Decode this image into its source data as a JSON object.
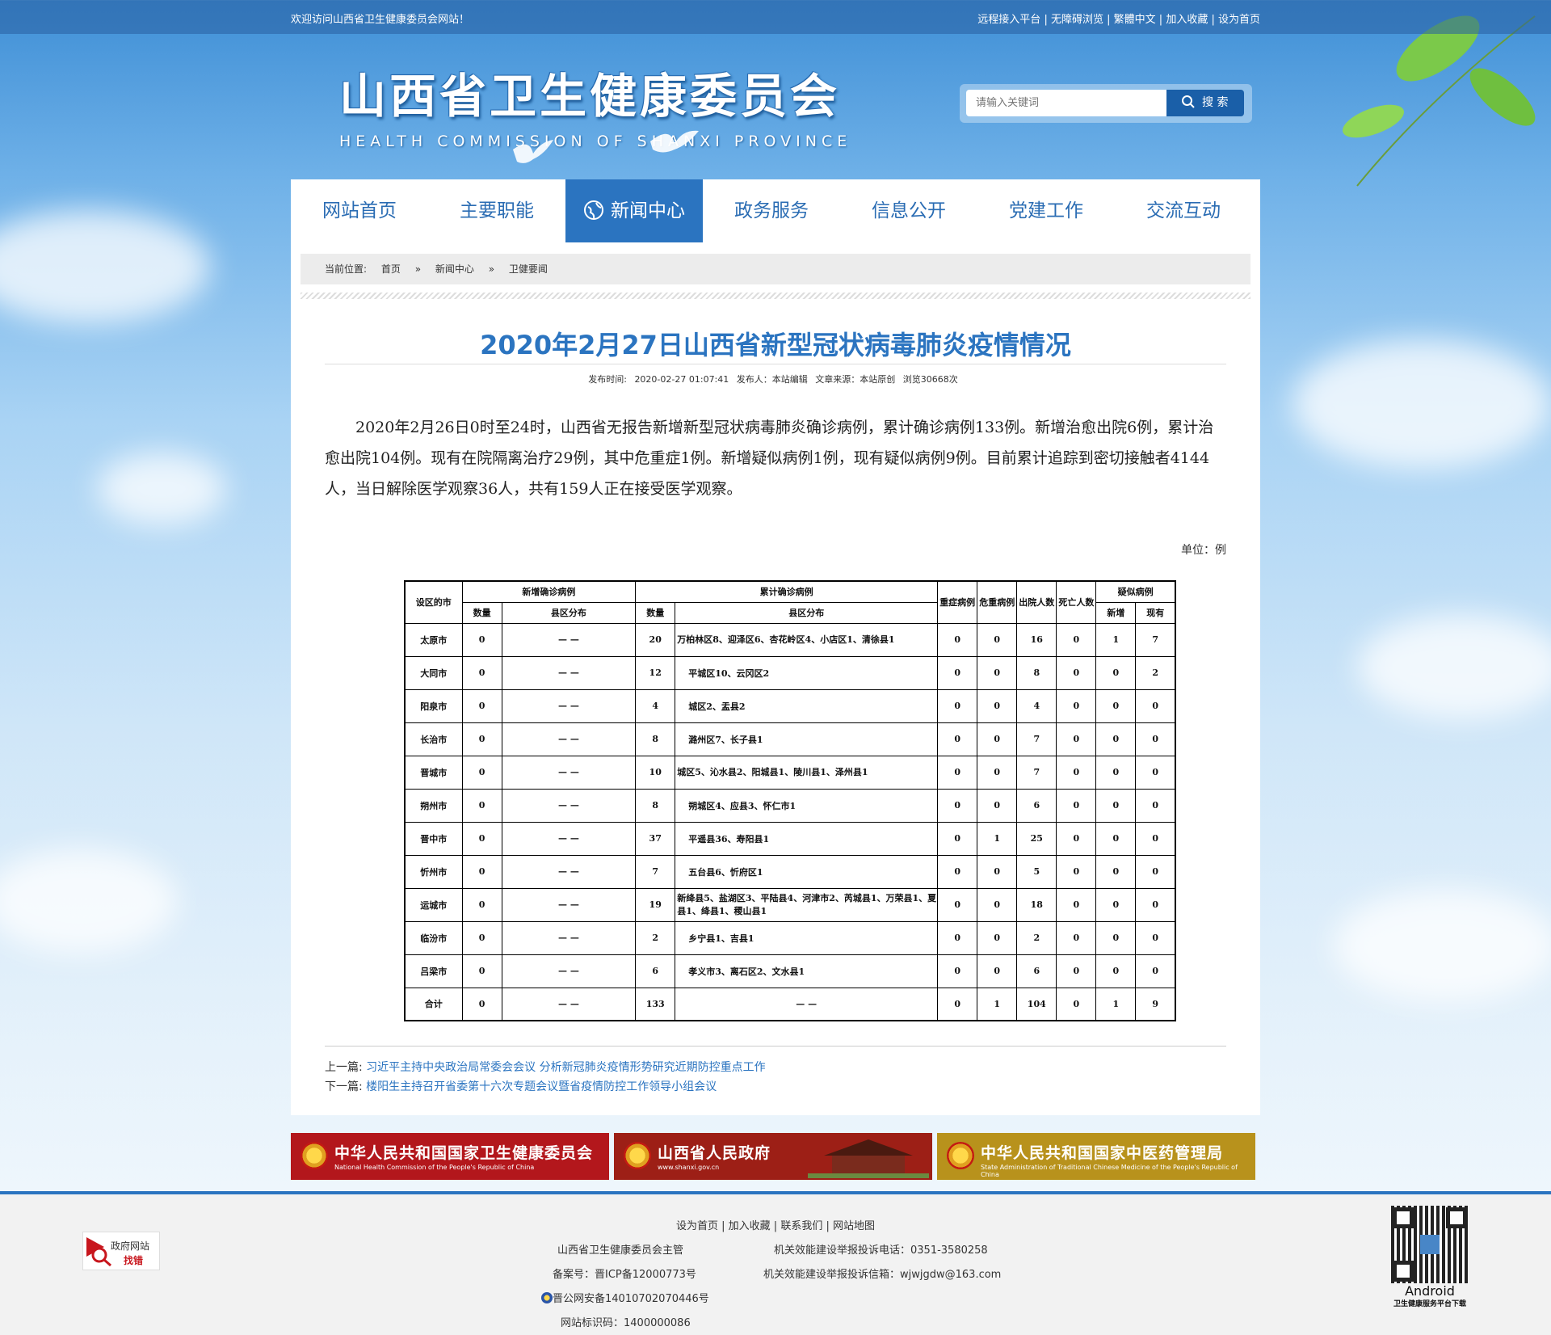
{
  "topbar": {
    "welcome": "欢迎访问山西省卫生健康委员会网站！",
    "links": [
      "远程接入平台",
      "无障碍浏览",
      "繁體中文",
      "加入收藏",
      "设为首页"
    ]
  },
  "brand": {
    "cn": "山西省卫生健康委员会",
    "en": "HEALTH COMMISSION OF SHANXI PROVINCE"
  },
  "search": {
    "placeholder": "请输入关键词",
    "button": "搜 索"
  },
  "nav": [
    "网站首页",
    "主要职能",
    "新闻中心",
    "政务服务",
    "信息公开",
    "党建工作",
    "交流互动"
  ],
  "breadcrumb": {
    "label": "当前位置:",
    "items": [
      "首页",
      "»",
      "新闻中心",
      "»",
      "卫健要闻"
    ]
  },
  "article": {
    "title": "2020年2月27日山西省新型冠状病毒肺炎疫情情况",
    "meta": {
      "time_label": "发布时间:",
      "time": "2020-02-27 01:07:41",
      "publisher": "发布人：本站编辑",
      "source": "文章来源：本站原创",
      "views": "浏览30668次"
    },
    "body": "2020年2月26日0时至24时，山西省无报告新增新型冠状病毒肺炎确诊病例，累计确诊病例133例。新增治愈出院6例，累计治愈出院104例。现有在院隔离治疗29例，其中危重症1例。新增疑似病例1例，现有疑似病例9例。目前累计追踪到密切接触者4144人，当日解除医学观察36人，共有159人正在接受医学观察。",
    "unit": "单位：例"
  },
  "table": {
    "headers": {
      "city": "设区的市",
      "new_confirmed": "新增确诊病例",
      "cum_confirmed": "累计确诊病例",
      "severe": "重症病例",
      "critical": "危重病例",
      "discharged": "出院人数",
      "deaths": "死亡人数",
      "suspected": "疑似病例",
      "count": "数量",
      "county": "县区分布",
      "new": "新增",
      "current": "现有"
    },
    "rows": [
      {
        "city": "太原市",
        "new_n": "0",
        "new_d": "— —",
        "cum_n": "20",
        "cum_d": "万柏林区8、迎泽区6、杏花岭区4、小店区1、清徐县1",
        "severe": "0",
        "critical": "0",
        "discharged": "16",
        "deaths": "0",
        "sus_new": "1",
        "sus_cur": "7"
      },
      {
        "city": "大同市",
        "new_n": "0",
        "new_d": "— —",
        "cum_n": "12",
        "cum_d": "平城区10、云冈区2",
        "severe": "0",
        "critical": "0",
        "discharged": "8",
        "deaths": "0",
        "sus_new": "0",
        "sus_cur": "2"
      },
      {
        "city": "阳泉市",
        "new_n": "0",
        "new_d": "— —",
        "cum_n": "4",
        "cum_d": "城区2、盂县2",
        "severe": "0",
        "critical": "0",
        "discharged": "4",
        "deaths": "0",
        "sus_new": "0",
        "sus_cur": "0"
      },
      {
        "city": "长治市",
        "new_n": "0",
        "new_d": "— —",
        "cum_n": "8",
        "cum_d": "潞州区7、长子县1",
        "severe": "0",
        "critical": "0",
        "discharged": "7",
        "deaths": "0",
        "sus_new": "0",
        "sus_cur": "0"
      },
      {
        "city": "晋城市",
        "new_n": "0",
        "new_d": "— —",
        "cum_n": "10",
        "cum_d": "城区5、沁水县2、阳城县1、陵川县1、泽州县1",
        "severe": "0",
        "critical": "0",
        "discharged": "7",
        "deaths": "0",
        "sus_new": "0",
        "sus_cur": "0"
      },
      {
        "city": "朔州市",
        "new_n": "0",
        "new_d": "— —",
        "cum_n": "8",
        "cum_d": "朔城区4、应县3、怀仁市1",
        "severe": "0",
        "critical": "0",
        "discharged": "6",
        "deaths": "0",
        "sus_new": "0",
        "sus_cur": "0"
      },
      {
        "city": "晋中市",
        "new_n": "0",
        "new_d": "— —",
        "cum_n": "37",
        "cum_d": "平遥县36、寿阳县1",
        "severe": "0",
        "critical": "1",
        "discharged": "25",
        "deaths": "0",
        "sus_new": "0",
        "sus_cur": "0"
      },
      {
        "city": "忻州市",
        "new_n": "0",
        "new_d": "— —",
        "cum_n": "7",
        "cum_d": "五台县6、忻府区1",
        "severe": "0",
        "critical": "0",
        "discharged": "5",
        "deaths": "0",
        "sus_new": "0",
        "sus_cur": "0"
      },
      {
        "city": "运城市",
        "new_n": "0",
        "new_d": "— —",
        "cum_n": "19",
        "cum_d": "新绛县5、盐湖区3、平陆县4、河津市2、芮城县1、万荣县1、夏县1、绛县1、稷山县1",
        "severe": "0",
        "critical": "0",
        "discharged": "18",
        "deaths": "0",
        "sus_new": "0",
        "sus_cur": "0"
      },
      {
        "city": "临汾市",
        "new_n": "0",
        "new_d": "— —",
        "cum_n": "2",
        "cum_d": "乡宁县1、吉县1",
        "severe": "0",
        "critical": "0",
        "discharged": "2",
        "deaths": "0",
        "sus_new": "0",
        "sus_cur": "0"
      },
      {
        "city": "吕梁市",
        "new_n": "0",
        "new_d": "— —",
        "cum_n": "6",
        "cum_d": "孝义市3、离石区2、文水县1",
        "severe": "0",
        "critical": "0",
        "discharged": "6",
        "deaths": "0",
        "sus_new": "0",
        "sus_cur": "0"
      },
      {
        "city": "合计",
        "new_n": "0",
        "new_d": "— —",
        "cum_n": "133",
        "cum_d": "— —",
        "severe": "0",
        "critical": "1",
        "discharged": "104",
        "deaths": "0",
        "sus_new": "1",
        "sus_cur": "9"
      }
    ]
  },
  "prevnext": {
    "prev_label": "上一篇:",
    "prev": "习近平主持中央政治局常委会会议 分析新冠肺炎疫情形势研究近期防控重点工作",
    "next_label": "下一篇:",
    "next": "楼阳生主持召开省委第十六次专题会议暨省疫情防控工作领导小组会议"
  },
  "banners": [
    {
      "title": "中华人民共和国国家卫生健康委员会",
      "sub": "National Health Commission of the People's Republic of China",
      "color": "#b3171c"
    },
    {
      "title": "山西省人民政府",
      "sub": "www.shanxi.gov.cn",
      "color": "#9d1f16"
    },
    {
      "title": "中华人民共和国国家中医药管理局",
      "sub": "State Administration of Traditional Chinese Medicine of the People's Republic of China",
      "color": "#b8921c"
    }
  ],
  "footer": {
    "links": [
      "设为首页",
      "加入收藏",
      "联系我们",
      "网站地图"
    ],
    "host": "山西省卫生健康委员会主管",
    "phone": "机关效能建设举报投诉电话：0351-3580258",
    "icp": "备案号：晋ICP备12000773号",
    "email": "机关效能建设举报投诉信箱：wjwjgdw@163.com",
    "police": "晋公网安备14010702070446号",
    "site_id": "网站标识码：1400000086",
    "gov_badge_1": "政府网站",
    "gov_badge_2": "找错",
    "android": "Android",
    "android_sub": "卫生健康服务平台下载"
  },
  "colors": {
    "primary": "#2b74c0",
    "topbar": "#2a5f9c",
    "footer_border": "#2b74c0"
  }
}
